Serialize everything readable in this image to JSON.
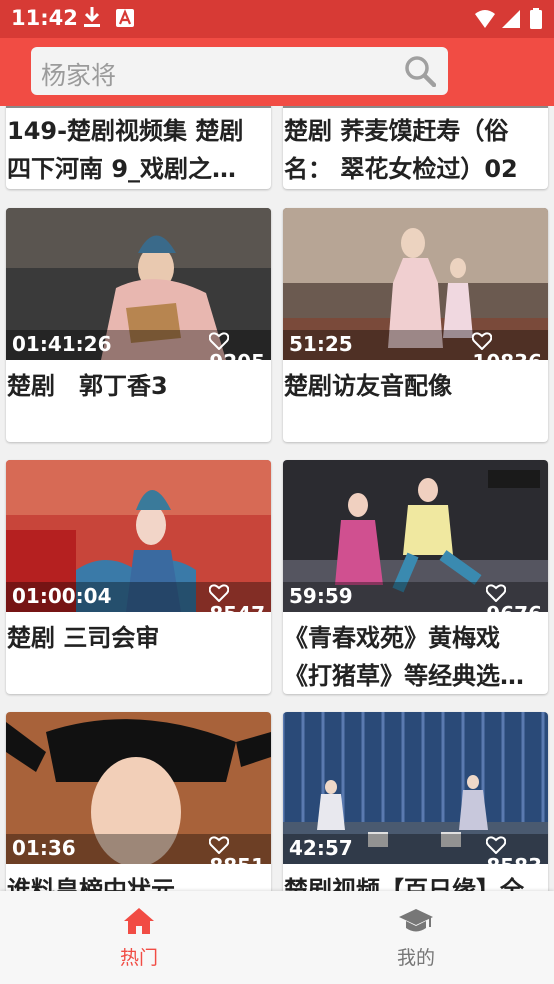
{
  "status_bar": {
    "time": "11:42",
    "icons": [
      "download-icon",
      "app-a-icon",
      "wifi-icon",
      "signal-icon",
      "battery-icon"
    ]
  },
  "search": {
    "placeholder": "杨家将"
  },
  "top_cards": [
    {
      "title_line1": "149-楚剧视频集 楚剧",
      "title_line2": "四下河南 9_戏剧之…"
    },
    {
      "title_line1": "楚剧 荞麦馍赶寿（俗",
      "title_line2": "名： 翠花女检过）02"
    }
  ],
  "cards": [
    {
      "duration": "01:41:26",
      "likes": "9205",
      "title_line1": "楚剧　郭丁香3",
      "title_line2": ""
    },
    {
      "duration": "51:25",
      "likes": "10836",
      "title_line1": "楚剧访友音配像",
      "title_line2": ""
    },
    {
      "duration": "01:00:04",
      "likes": "8547",
      "title_line1": "楚剧  三司会审",
      "title_line2": ""
    },
    {
      "duration": "59:59",
      "likes": "9676",
      "title_line1": "《青春戏苑》黄梅戏",
      "title_line2": "《打猪草》等经典选…"
    },
    {
      "duration": "01:36",
      "likes": "8851",
      "title_line1": "谁料皇榜中状元",
      "title_line2": ""
    },
    {
      "duration": "42:57",
      "likes": "8583",
      "title_line1": "楚剧视频【百日缘】全",
      "title_line2": ""
    }
  ],
  "bottom_nav": [
    {
      "label": "热门",
      "icon": "home-icon",
      "active": true
    },
    {
      "label": "我的",
      "icon": "graduation-cap-icon",
      "active": false
    }
  ],
  "colors": {
    "status_bar": "#d73a35",
    "top_bar": "#f14c44",
    "active_nav": "#f14c44",
    "inactive_nav": "#777777"
  }
}
